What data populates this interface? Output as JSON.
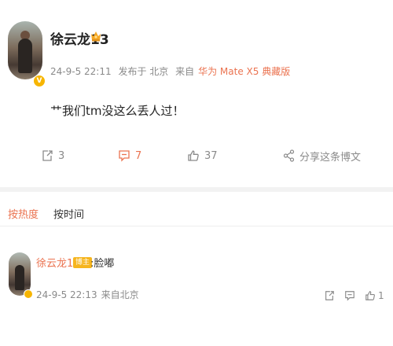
{
  "post": {
    "author": {
      "name": "徐云龙13",
      "badge_icon": "crown-icon",
      "verify_icon": "verified-v-icon"
    },
    "meta": {
      "time": "24-9-5 22:11",
      "location": "发布于 北京",
      "source_prefix": "来自",
      "device": "华为 Mate X5 典藏版"
    },
    "text": "艹我们tm没这么丢人过！",
    "actions": {
      "repost_count": "3",
      "comment_count": "7",
      "like_count": "37",
      "share_label": "分享这条博文"
    }
  },
  "comments_section": {
    "sort_tabs": [
      {
        "label": "按热度",
        "active": true
      },
      {
        "label": "按时间",
        "active": false
      }
    ],
    "comments": [
      {
        "author": "徐云龙13",
        "tag": "博主",
        "text": ":脸嘟",
        "time": "24-9-5 22:13",
        "location": "来自北京",
        "like_count": "1"
      }
    ]
  },
  "colors": {
    "accent": "#eb7350",
    "muted": "#8a8a8a",
    "text": "#222222",
    "verify": "#f7b500"
  }
}
